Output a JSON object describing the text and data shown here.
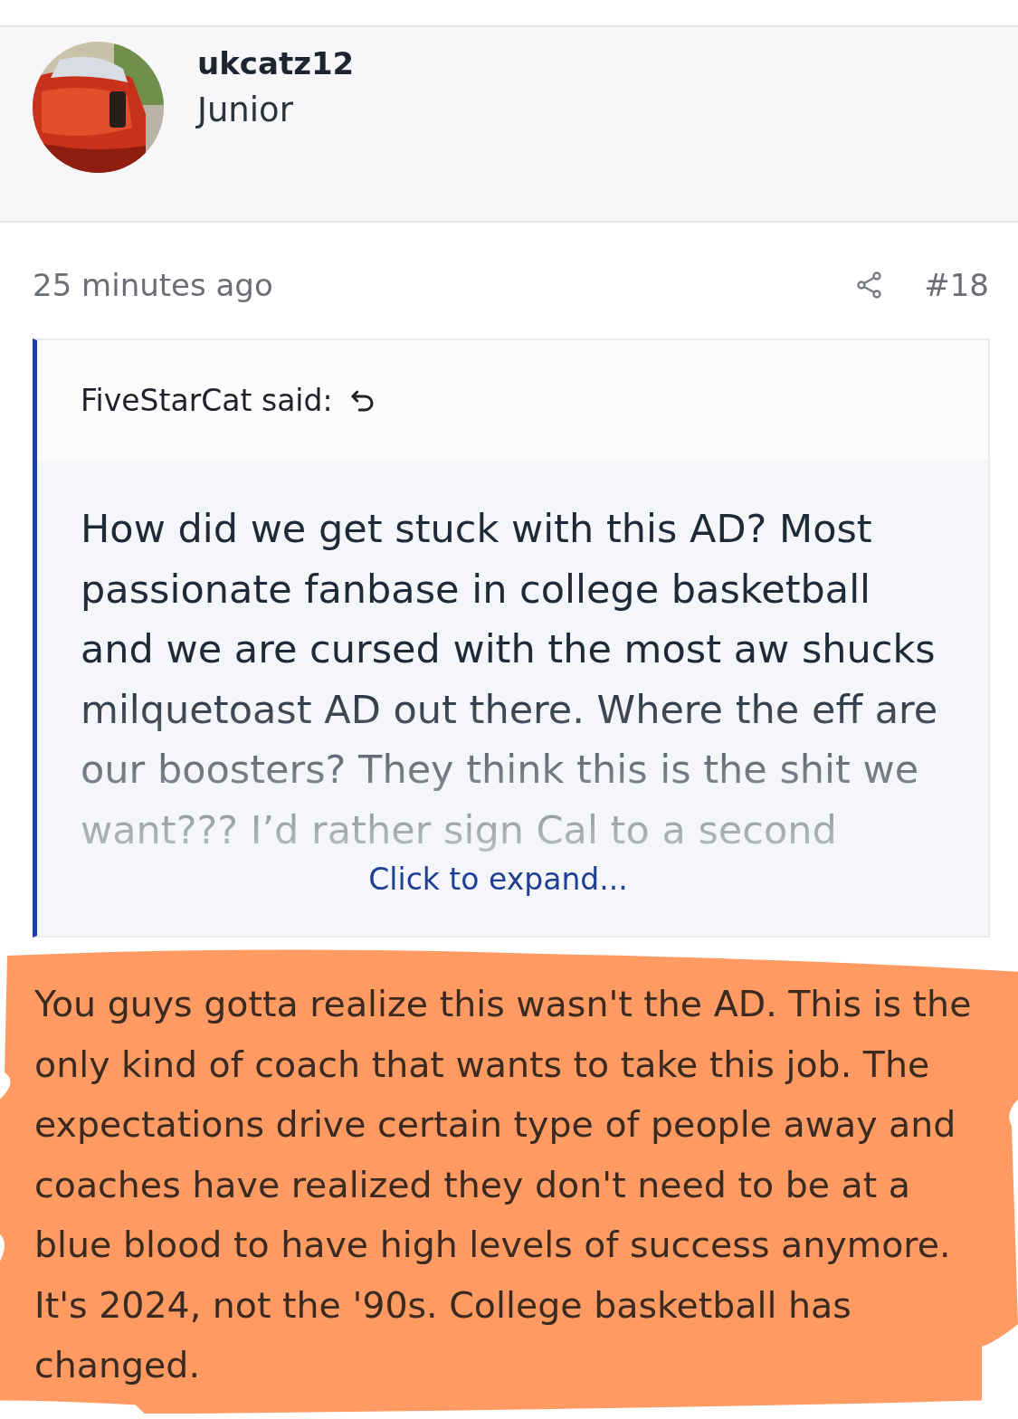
{
  "author": {
    "username": "ukcatz12",
    "rank": "Junior"
  },
  "post": {
    "time": "25 minutes ago",
    "number": "#18",
    "quote": {
      "attribution": "FiveStarCat said:",
      "text": "How did we get stuck with this AD? Most passionate fanbase in college basketball and we are cursed with the most aw shucks milquetoast AD out there. Where the eff are our boosters? They think this is the shit we want??? I’d rather sign Cal to a second",
      "expand": "Click to expand..."
    },
    "body": "You guys gotta realize this wasn't the AD. This is the only kind of coach that wants to take this job. The expectations drive certain type of people away and coaches have realized they don't need to be at a blue blood to have high levels of success anymore. It's 2024, not the '90s. College basketball has changed."
  }
}
